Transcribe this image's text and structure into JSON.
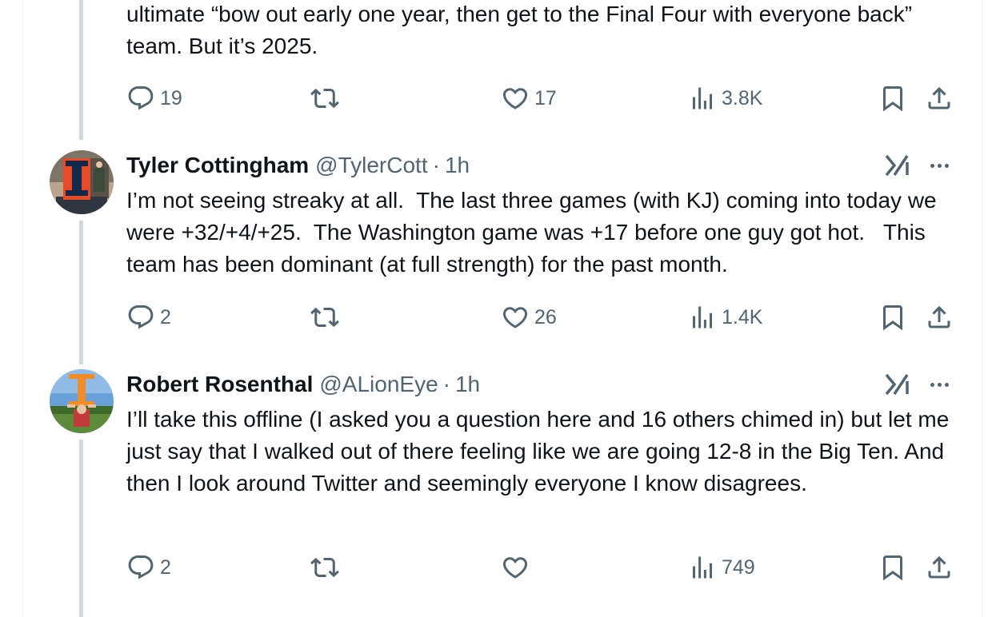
{
  "tweets": [
    {
      "text": "ultimate “bow out early one year, then get to the Final Four with everyone back” team. But it’s 2025.",
      "actions": {
        "replies": "19",
        "retweets": "",
        "likes": "17",
        "views": "3.8K"
      }
    },
    {
      "display_name": "Tyler Cottingham",
      "handle": "@TylerCott",
      "separator": "·",
      "time": "1h",
      "avatar": "illinois-block-i-avatar",
      "text": "I’m not seeing streaky at all.  The last three games (with KJ) coming into today we were +32/+4/+25.  The Washington game was +17 before one guy got hot.   This team has been dominant (at full strength) for the past month.",
      "actions": {
        "replies": "2",
        "retweets": "",
        "likes": "26",
        "views": "1.4K"
      }
    },
    {
      "display_name": "Robert Rosenthal",
      "handle": "@ALionEye",
      "separator": "·",
      "time": "1h",
      "avatar": "illinois-i-sign-avatar",
      "text": "I’ll take this offline (I asked you a question here and 16 others chimed in) but let me just say that I walked out of there feeling like we are going 12-8 in the Big Ten. And then I look around Twitter and seemingly everyone I know disagrees.",
      "actions": {
        "replies": "2",
        "retweets": "",
        "likes": "",
        "views": "749"
      }
    }
  ],
  "icons": {
    "reply": "reply-icon",
    "retweet": "retweet-icon",
    "like": "heart-icon",
    "views": "views-icon",
    "bookmark": "bookmark-icon",
    "share": "share-icon",
    "grok": "grok-icon",
    "more": "more-icon"
  },
  "colors": {
    "text": "#0f1419",
    "secondary": "#536471",
    "thread_line": "#cfd9de",
    "illinois_orange": "#e84a27",
    "illinois_blue": "#13294b"
  }
}
